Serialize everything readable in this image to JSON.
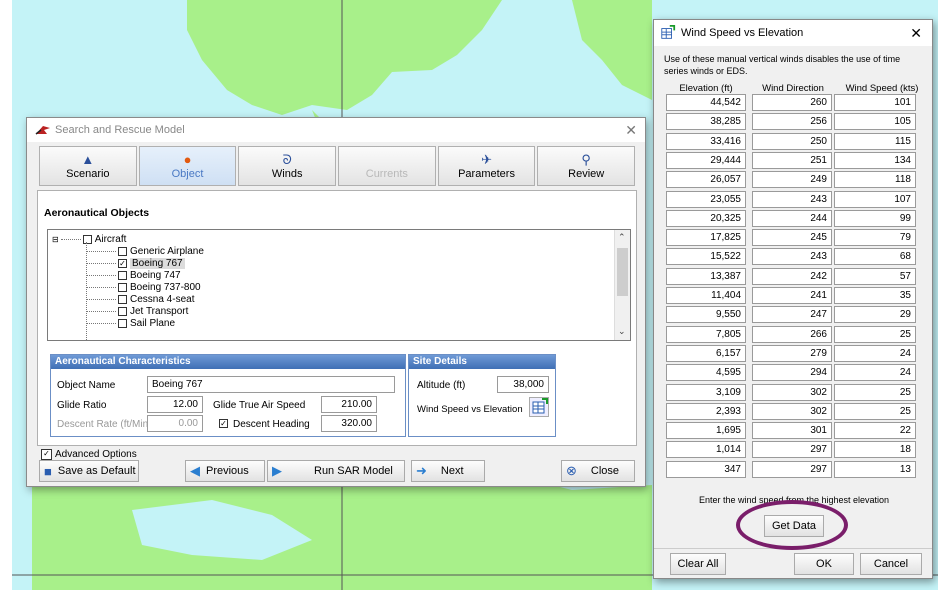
{
  "sar_dialog": {
    "title": "Search and Rescue Model",
    "tabs": [
      {
        "label": "Scenario",
        "icon": "warning-icon"
      },
      {
        "label": "Object",
        "icon": "drop-icon"
      },
      {
        "label": "Winds",
        "icon": "wind-icon"
      },
      {
        "label": "Currents",
        "icon": "currents-icon"
      },
      {
        "label": "Parameters",
        "icon": "plane-icon"
      },
      {
        "label": "Review",
        "icon": "magnifier-icon"
      }
    ],
    "section_title": "Aeronautical Objects",
    "tree": {
      "root": "Aircraft",
      "items": [
        "Generic Airplane",
        "Boeing 767",
        "Boeing 747",
        "Boeing 737-800",
        "Cessna 4-seat",
        "Jet Transport",
        "Sail Plane"
      ],
      "checked_item": "Boeing 767"
    },
    "characteristics": {
      "header": "Aeronautical Characteristics",
      "object_name_label": "Object Name",
      "object_name": "Boeing 767",
      "glide_ratio_label": "Glide Ratio",
      "glide_ratio": "12.00",
      "glide_tas_label": "Glide True Air Speed",
      "glide_tas": "210.00",
      "descent_rate_label": "Descent Rate (ft/Min)",
      "descent_rate": "0.00",
      "descent_heading_label": "Descent Heading",
      "descent_heading": "320.00"
    },
    "site": {
      "header": "Site Details",
      "altitude_label": "Altitude (ft)",
      "altitude": "38,000",
      "wind_label": "Wind Speed vs Elevation"
    },
    "advanced_options": "Advanced Options",
    "buttons": {
      "save_default": "Save as Default",
      "previous": "Previous",
      "run": "Run SAR Model",
      "next": "Next",
      "close": "Close"
    }
  },
  "wind_dialog": {
    "title": "Wind Speed vs Elevation",
    "info": "Use of these manual vertical winds disables the use of time series winds or EDS.",
    "columns": [
      "Elevation (ft)",
      "Wind Direction",
      "Wind Speed (kts)"
    ],
    "rows": [
      [
        "44,542",
        "260",
        "101"
      ],
      [
        "38,285",
        "256",
        "105"
      ],
      [
        "33,416",
        "250",
        "115"
      ],
      [
        "29,444",
        "251",
        "134"
      ],
      [
        "26,057",
        "249",
        "118"
      ],
      [
        "23,055",
        "243",
        "107"
      ],
      [
        "20,325",
        "244",
        "99"
      ],
      [
        "17,825",
        "245",
        "79"
      ],
      [
        "15,522",
        "243",
        "68"
      ],
      [
        "13,387",
        "242",
        "57"
      ],
      [
        "11,404",
        "241",
        "35"
      ],
      [
        "9,550",
        "247",
        "29"
      ],
      [
        "7,805",
        "266",
        "25"
      ],
      [
        "6,157",
        "279",
        "24"
      ],
      [
        "4,595",
        "294",
        "24"
      ],
      [
        "3,109",
        "302",
        "25"
      ],
      [
        "2,393",
        "302",
        "25"
      ],
      [
        "1,695",
        "301",
        "22"
      ],
      [
        "1,014",
        "297",
        "18"
      ],
      [
        "347",
        "297",
        "13"
      ]
    ],
    "note": "Enter the wind speed from the highest elevation",
    "get_data": "Get Data",
    "clear_all": "Clear All",
    "ok": "OK",
    "cancel": "Cancel"
  },
  "colors": {
    "map_water": "#c4f3f7",
    "map_land": "#a8f08a",
    "accent_blue": "#3f6fb5",
    "highlight_circle": "#7a1e6a"
  }
}
